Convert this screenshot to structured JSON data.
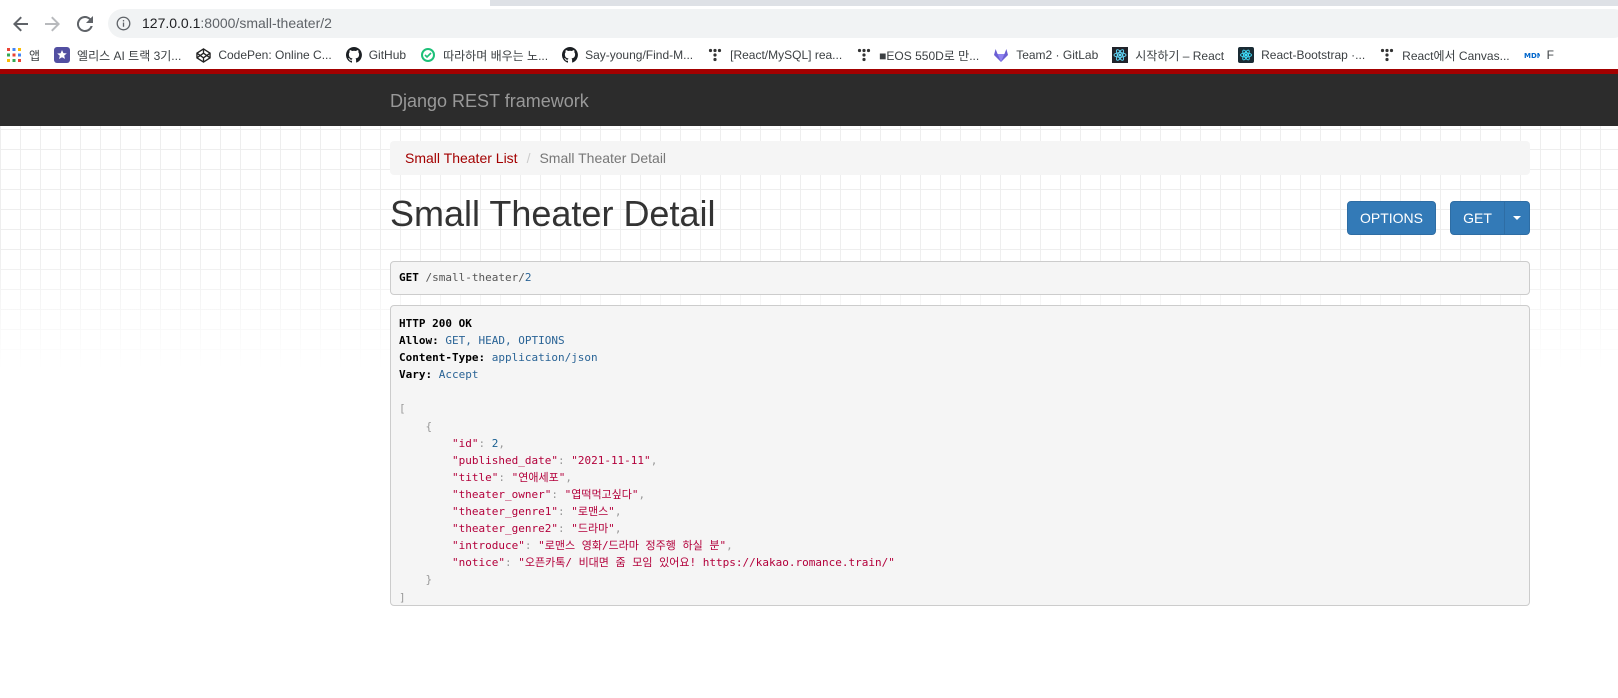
{
  "browser": {
    "url_host": "127.0.0.1",
    "url_path": ":8000/small-theater/2",
    "bookmarks": [
      {
        "label": "앱",
        "icon": "apps-grid-icon"
      },
      {
        "label": "엘리스 AI 트랙 3기...",
        "icon": "elice-icon"
      },
      {
        "label": "CodePen: Online C...",
        "icon": "codepen-icon"
      },
      {
        "label": "GitHub",
        "icon": "github-icon"
      },
      {
        "label": "따라하며 배우는 노...",
        "icon": "inflearn-icon"
      },
      {
        "label": "Say-young/Find-M...",
        "icon": "github-icon"
      },
      {
        "label": "[React/MySQL] rea...",
        "icon": "tistory-icon"
      },
      {
        "label": "■EOS 550D로 만...",
        "icon": "tistory-icon"
      },
      {
        "label": "Team2 · GitLab",
        "icon": "gitlab-icon"
      },
      {
        "label": "시작하기 – React",
        "icon": "react-icon"
      },
      {
        "label": "React-Bootstrap ·...",
        "icon": "react-bootstrap-icon"
      },
      {
        "label": "React에서 Canvas...",
        "icon": "tistory-icon"
      },
      {
        "label": "F",
        "icon": "mdn-icon"
      }
    ]
  },
  "navbar": {
    "brand": "Django REST framework",
    "accent_color": "#a30000",
    "background_color": "#2c2c2c"
  },
  "breadcrumb": {
    "link_label": "Small Theater List",
    "separator": "/",
    "active_label": "Small Theater Detail"
  },
  "page": {
    "title": "Small Theater Detail",
    "options_button": "OPTIONS",
    "get_button": "GET"
  },
  "request": {
    "method": "GET",
    "path_prefix": "/small-theater",
    "path_slash": "/",
    "path_id": "2"
  },
  "response": {
    "status_line": "HTTP 200 OK",
    "headers": [
      {
        "key": "Allow:",
        "value": "GET, HEAD, OPTIONS"
      },
      {
        "key": "Content-Type:",
        "value": "application/json"
      },
      {
        "key": "Vary:",
        "value": "Accept"
      }
    ],
    "body": {
      "open_bracket": "[",
      "open_brace": "{",
      "fields": [
        {
          "key": "\"id\"",
          "value": "2",
          "type": "num",
          "comma": ","
        },
        {
          "key": "\"published_date\"",
          "value": "\"2021-11-11\"",
          "type": "str",
          "comma": ","
        },
        {
          "key": "\"title\"",
          "value": "\"연애세포\"",
          "type": "str",
          "comma": ","
        },
        {
          "key": "\"theater_owner\"",
          "value": "\"엽떡먹고싶다\"",
          "type": "str",
          "comma": ","
        },
        {
          "key": "\"theater_genre1\"",
          "value": "\"로맨스\"",
          "type": "str",
          "comma": ","
        },
        {
          "key": "\"theater_genre2\"",
          "value": "\"드라마\"",
          "type": "str",
          "comma": ","
        },
        {
          "key": "\"introduce\"",
          "value": "\"로맨스 영화/드라마 정주행 하실 분\"",
          "type": "str",
          "comma": ","
        },
        {
          "key": "\"notice\"",
          "value": "\"오픈카톡/ 비대면 줌 모임 있어요! https://kakao.romance.train/\"",
          "type": "str",
          "comma": ""
        }
      ],
      "close_brace": "}",
      "close_bracket": "]"
    }
  }
}
